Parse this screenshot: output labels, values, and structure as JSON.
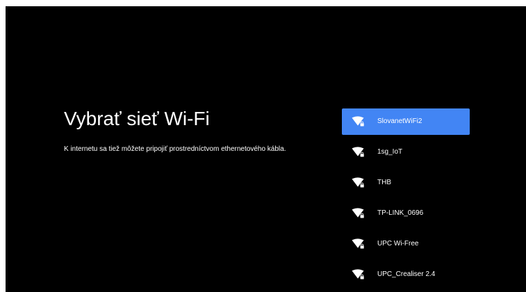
{
  "setup": {
    "title": "Vybrať sieť Wi-Fi",
    "subtitle": "K internetu sa tiež môžete pripojiť prostredníctvom ethernetového kábla."
  },
  "networks": [
    {
      "name": "SlovanetWiFi2",
      "selected": true,
      "icon": "wifi-lock-icon"
    },
    {
      "name": "1sg_IoT",
      "selected": false,
      "icon": "wifi-lock-icon"
    },
    {
      "name": "THB",
      "selected": false,
      "icon": "wifi-lock-icon"
    },
    {
      "name": "TP-LINK_0696",
      "selected": false,
      "icon": "wifi-lock-icon"
    },
    {
      "name": "UPC Wi-Free",
      "selected": false,
      "icon": "wifi-lock-icon"
    },
    {
      "name": "UPC_Crealiser 2.4",
      "selected": false,
      "icon": "wifi-lock-icon"
    }
  ],
  "colors": {
    "background": "#000000",
    "text": "#ffffff",
    "selected": "#4285f4"
  }
}
